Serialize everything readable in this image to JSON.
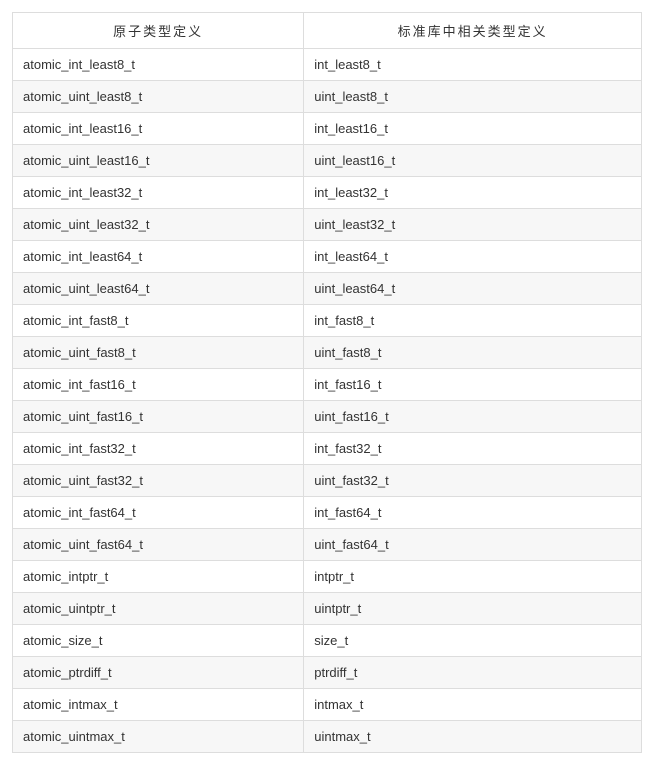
{
  "table": {
    "headers": {
      "col1": "原子类型定义",
      "col2": "标准库中相关类型定义"
    },
    "rows": [
      {
        "col1": "atomic_int_least8_t",
        "col2": "int_least8_t"
      },
      {
        "col1": "atomic_uint_least8_t",
        "col2": "uint_least8_t"
      },
      {
        "col1": "atomic_int_least16_t",
        "col2": "int_least16_t"
      },
      {
        "col1": "atomic_uint_least16_t",
        "col2": "uint_least16_t"
      },
      {
        "col1": "atomic_int_least32_t",
        "col2": "int_least32_t"
      },
      {
        "col1": "atomic_uint_least32_t",
        "col2": "uint_least32_t"
      },
      {
        "col1": "atomic_int_least64_t",
        "col2": "int_least64_t"
      },
      {
        "col1": "atomic_uint_least64_t",
        "col2": "uint_least64_t"
      },
      {
        "col1": "atomic_int_fast8_t",
        "col2": "int_fast8_t"
      },
      {
        "col1": "atomic_uint_fast8_t",
        "col2": "uint_fast8_t"
      },
      {
        "col1": "atomic_int_fast16_t",
        "col2": "int_fast16_t"
      },
      {
        "col1": "atomic_uint_fast16_t",
        "col2": "uint_fast16_t"
      },
      {
        "col1": "atomic_int_fast32_t",
        "col2": "int_fast32_t"
      },
      {
        "col1": "atomic_uint_fast32_t",
        "col2": "uint_fast32_t"
      },
      {
        "col1": "atomic_int_fast64_t",
        "col2": "int_fast64_t"
      },
      {
        "col1": "atomic_uint_fast64_t",
        "col2": "uint_fast64_t"
      },
      {
        "col1": "atomic_intptr_t",
        "col2": "intptr_t"
      },
      {
        "col1": "atomic_uintptr_t",
        "col2": "uintptr_t"
      },
      {
        "col1": "atomic_size_t",
        "col2": "size_t"
      },
      {
        "col1": "atomic_ptrdiff_t",
        "col2": "ptrdiff_t"
      },
      {
        "col1": "atomic_intmax_t",
        "col2": "intmax_t"
      },
      {
        "col1": "atomic_uintmax_t",
        "col2": "uintmax_t"
      }
    ]
  }
}
